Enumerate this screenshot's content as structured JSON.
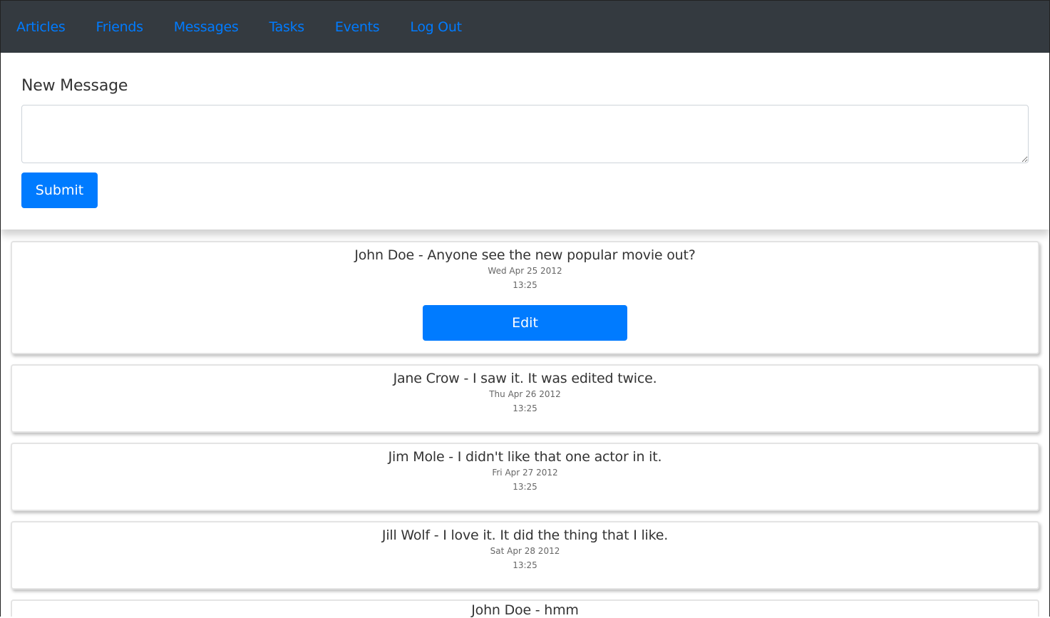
{
  "nav": {
    "items": [
      "Articles",
      "Friends",
      "Messages",
      "Tasks",
      "Events",
      "Log Out"
    ]
  },
  "form": {
    "title": "New Message",
    "value": "",
    "submit_label": "Submit"
  },
  "messages": [
    {
      "text": "John Doe - Anyone see the new popular movie out?",
      "date": "Wed Apr 25 2012",
      "time": "13:25",
      "edit_label": "Edit"
    },
    {
      "text": "Jane Crow - I saw it. It was edited twice.",
      "date": "Thu Apr 26 2012",
      "time": "13:25"
    },
    {
      "text": "Jim Mole - I didn't like that one actor in it.",
      "date": "Fri Apr 27 2012",
      "time": "13:25"
    },
    {
      "text": "Jill Wolf - I love it. It did the thing that I like.",
      "date": "Sat Apr 28 2012",
      "time": "13:25"
    },
    {
      "text": "John Doe - hmm"
    }
  ],
  "colors": {
    "navbar": "#343a40",
    "link": "#007bff",
    "primary": "#007bff"
  }
}
